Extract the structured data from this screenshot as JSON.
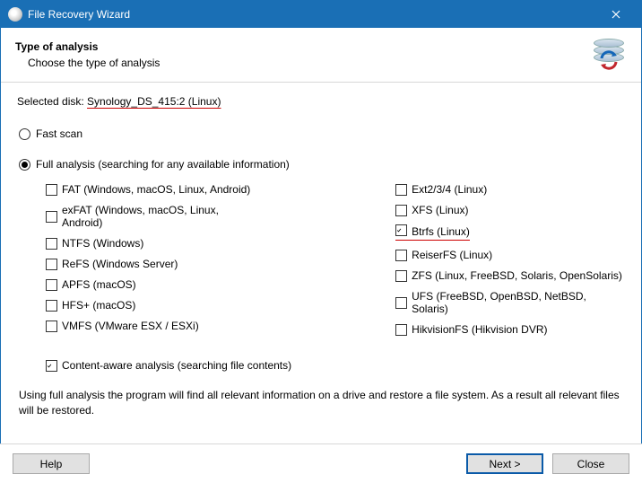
{
  "window": {
    "title": "File Recovery Wizard"
  },
  "header": {
    "heading": "Type of analysis",
    "subhead": "Choose the type of analysis"
  },
  "selected": {
    "label": "Selected disk: ",
    "value": "Synology_DS_415:2 (Linux)"
  },
  "scan": {
    "fast": {
      "label": "Fast scan",
      "checked": false
    },
    "full": {
      "label": "Full analysis (searching for any available information)",
      "checked": true
    }
  },
  "fs_left": [
    {
      "label": "FAT (Windows, macOS, Linux, Android)",
      "checked": false
    },
    {
      "label": "exFAT (Windows, macOS, Linux, Android)",
      "checked": false
    },
    {
      "label": "NTFS (Windows)",
      "checked": false
    },
    {
      "label": "ReFS (Windows Server)",
      "checked": false
    },
    {
      "label": "APFS (macOS)",
      "checked": false
    },
    {
      "label": "HFS+ (macOS)",
      "checked": false
    },
    {
      "label": "VMFS (VMware ESX / ESXi)",
      "checked": false
    }
  ],
  "fs_right": [
    {
      "label": "Ext2/3/4 (Linux)",
      "checked": false
    },
    {
      "label": "XFS (Linux)",
      "checked": false
    },
    {
      "label": "Btrfs (Linux)",
      "checked": true,
      "highlight": true
    },
    {
      "label": "ReiserFS (Linux)",
      "checked": false
    },
    {
      "label": "ZFS (Linux, FreeBSD, Solaris, OpenSolaris)",
      "checked": false
    },
    {
      "label": "UFS (FreeBSD, OpenBSD, NetBSD, Solaris)",
      "checked": false
    },
    {
      "label": "HikvisionFS (Hikvision DVR)",
      "checked": false
    }
  ],
  "content_aware": {
    "label": "Content-aware analysis (searching file contents)",
    "checked": true
  },
  "description": "Using full analysis the program will find all relevant information on a drive and restore a file system. As a result all relevant files will be restored.",
  "buttons": {
    "help": "Help",
    "next": "Next >",
    "close": "Close"
  }
}
